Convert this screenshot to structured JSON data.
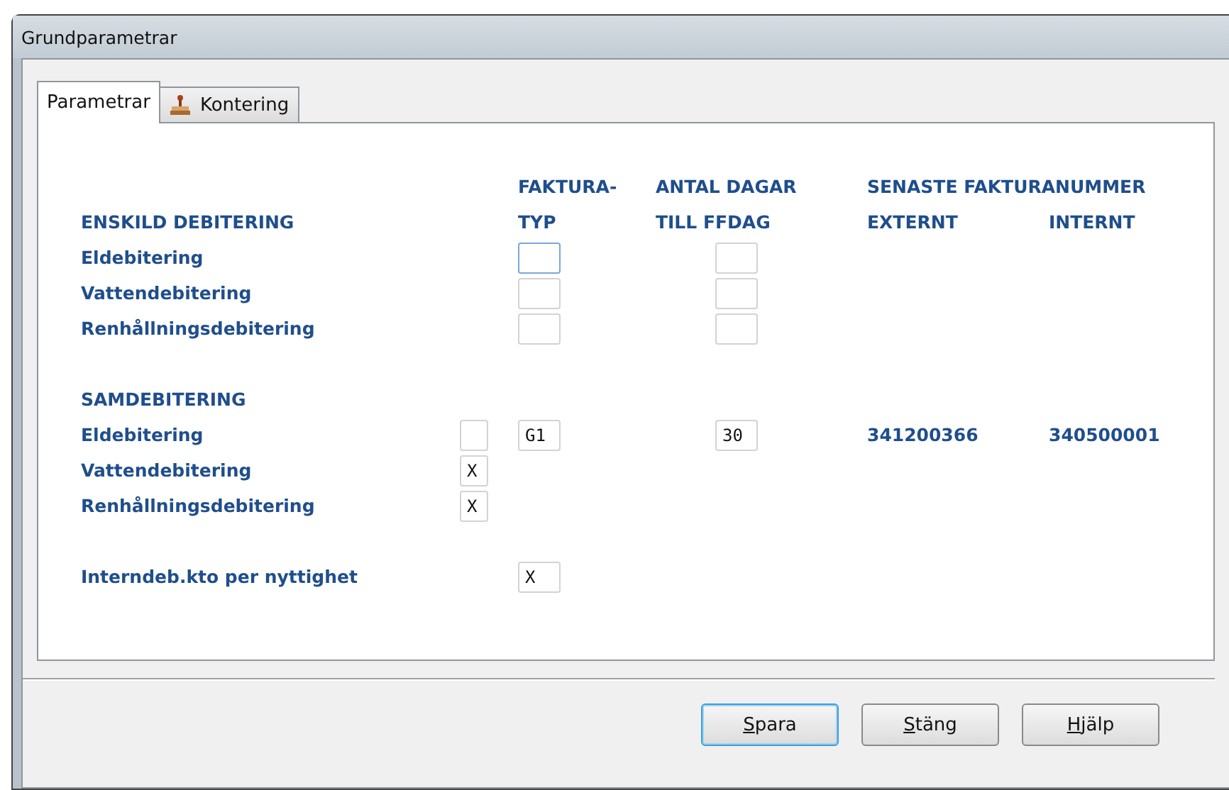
{
  "window": {
    "title": "Grundparametrar"
  },
  "tabs": [
    {
      "label": "Parametrar",
      "selected": true,
      "icon": false
    },
    {
      "label": "Kontering",
      "selected": false,
      "icon": true
    }
  ],
  "headings": {
    "type": [
      "FAKTURA-",
      "TYP"
    ],
    "days": [
      "ANTAL DAGAR",
      "TILL FFDAG"
    ],
    "invoice_numbers": "SENASTE FAKTURANUMMER",
    "external": "EXTERNT",
    "internal": "INTERNT"
  },
  "sections": [
    {
      "heading": "ENSKILD DEBITERING",
      "rows": [
        {
          "label": "Eldebitering",
          "type": {
            "focused": true
          },
          "days": {
            "focused": false
          }
        },
        {
          "label": "Vattendebitering",
          "type": {
            "focused": false
          },
          "days": {
            "focused": false
          }
        },
        {
          "label": "Renhållningsdebitering",
          "type": {
            "focused": false
          },
          "days": {
            "focused": false
          }
        }
      ]
    },
    {
      "heading": "SAMDEBITERING",
      "rows": [
        {
          "label": "Eldebitering",
          "flag": {
            "focused": false
          },
          "type": {
            "value": "G1",
            "focused": false
          },
          "days": {
            "value": "30",
            "focused": false
          },
          "external": "341200366",
          "internal": "340500001"
        },
        {
          "label": "Vattendebitering",
          "flag": {
            "value": "X",
            "focused": false
          }
        },
        {
          "label": "Renhållningsdebitering",
          "flag": {
            "value": "X",
            "focused": false
          }
        }
      ]
    },
    {
      "rows": [
        {
          "label": "Interndeb.kto per nyttighet",
          "type": {
            "value": "X",
            "focused": false
          }
        }
      ]
    }
  ],
  "buttons": [
    {
      "label": "Spara",
      "default": true
    },
    {
      "label": "Stäng",
      "default": false
    },
    {
      "label": "Hjälp",
      "default": false
    }
  ]
}
